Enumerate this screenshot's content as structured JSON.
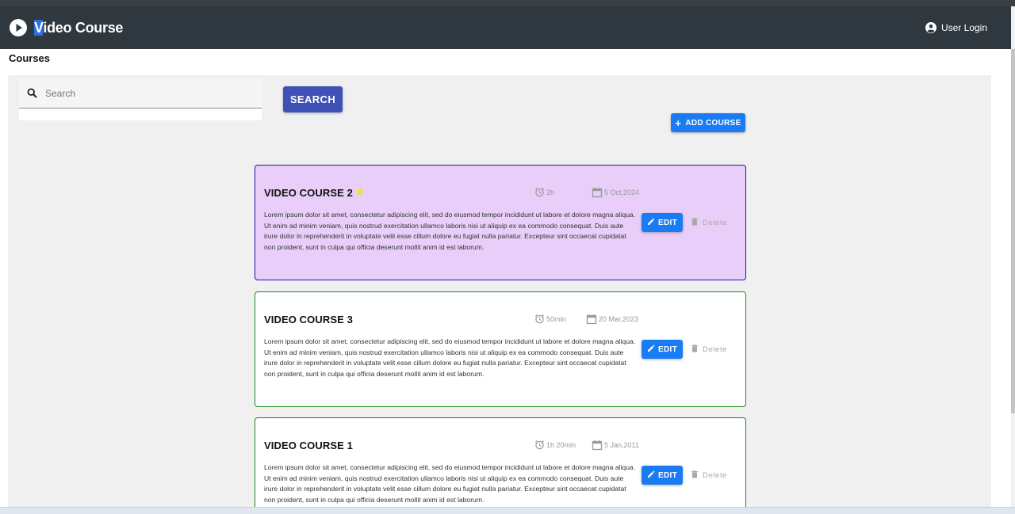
{
  "app": {
    "title_first_letter": "V",
    "title_rest": "ideo Course",
    "user_login": "User Login"
  },
  "page": {
    "heading": "Courses"
  },
  "search": {
    "placeholder": "Search",
    "button_label": "SEARCH"
  },
  "add_course": {
    "label": "ADD COURSE"
  },
  "colors": {
    "appbar": "#2e383e",
    "primary": "#3f51b5",
    "action": "#1a7cf5",
    "featured_bg": "#e8cef8",
    "featured_border": "#1515c4",
    "card_border": "#1a8a1a",
    "star": "#f7e600"
  },
  "courses": [
    {
      "title": "VIDEO COURSE 2",
      "starred": true,
      "duration": "2h",
      "date": "5 Oct,2024",
      "description": "Lorem ipsum dolor sit amet, consectetur adipiscing elit, sed do eiusmod tempor incididunt ut labore et dolore magna aliqua. Ut enim ad minim veniam, quis nostrud exercitation ullamco laboris nisi ut aliquip ex ea commodo consequat. Duis aute irure dolor in reprehenderit in voluptate velit esse cillum dolore eu fugiat nulla pariatur. Excepteur sint occaecat cupidatat non proident, sunt in culpa qui officia deserunt mollit anim id est laborum.",
      "edit_label": "EDIT",
      "delete_label": "Delete"
    },
    {
      "title": "VIDEO COURSE 3",
      "starred": false,
      "duration": "50min",
      "date": "20 Mar,2023",
      "description": "Lorem ipsum dolor sit amet, consectetur adipiscing elit, sed do eiusmod tempor incididunt ut labore et dolore magna aliqua. Ut enim ad minim veniam, quis nostrud exercitation ullamco laboris nisi ut aliquip ex ea commodo consequat. Duis aute irure dolor in reprehenderit in voluptate velit esse cillum dolore eu fugiat nulla pariatur. Excepteur sint occaecat cupidatat non proident, sunt in culpa qui officia deserunt mollit anim id est laborum.",
      "edit_label": "EDIT",
      "delete_label": "Delete"
    },
    {
      "title": "VIDEO COURSE 1",
      "starred": false,
      "duration": "1h 20min",
      "date": "5 Jan,2011",
      "description": "Lorem ipsum dolor sit amet, consectetur adipiscing elit, sed do eiusmod tempor incididunt ut labore et dolore magna aliqua. Ut enim ad minim veniam, quis nostrud exercitation ullamco laboris nisi ut aliquip ex ea commodo consequat. Duis aute irure dolor in reprehenderit in voluptate velit esse cillum dolore eu fugiat nulla pariatur. Excepteur sint occaecat cupidatat non proident, sunt in culpa qui officia deserunt mollit anim id est laborum.",
      "edit_label": "EDIT",
      "delete_label": "Delete"
    }
  ]
}
